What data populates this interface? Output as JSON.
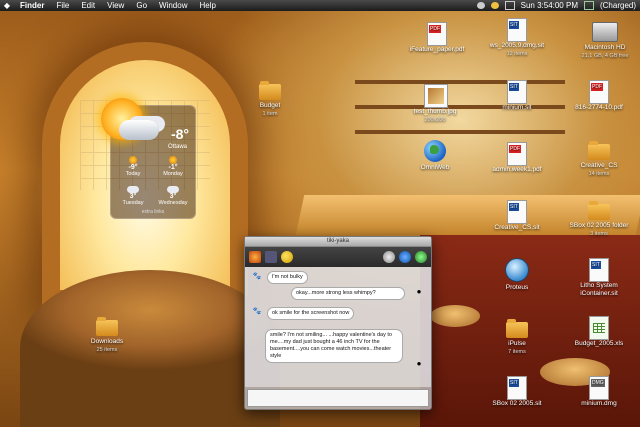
{
  "menubar": {
    "apple": "",
    "items": [
      "Finder",
      "File",
      "Edit",
      "View",
      "Go",
      "Window",
      "Help"
    ],
    "clock": "Sun 3:54:00 PM",
    "battery": "(Charged)"
  },
  "weather": {
    "city": "Ottawa",
    "temp": "-8°",
    "days": [
      {
        "label": "Today",
        "temp": "-9°",
        "icon": "sunny"
      },
      {
        "label": "Monday",
        "temp": "-1°",
        "icon": "sunny"
      },
      {
        "label": "Tuesday",
        "temp": "3°",
        "icon": "cloudy"
      },
      {
        "label": "Wednesday",
        "temp": "3°",
        "icon": "cloudy"
      }
    ],
    "extra": "extra links"
  },
  "icons": {
    "budget": {
      "label": "Budget",
      "sub": "1 item"
    },
    "downloads": {
      "label": "Downloads",
      "sub": "25 items"
    },
    "pdf_top": {
      "label": "iFeature_paper.pdf"
    },
    "zip_top": {
      "label": "ws_2005.9.dmg.sit",
      "sub": "12 items"
    },
    "macintosh_hd": {
      "label": "Macintosh HD",
      "sub": "21.1 GB, 4 GB free"
    },
    "test_thumb": {
      "label": "test_thumb.jpg",
      "sub": "200x200"
    },
    "minium_sit": {
      "label": "minium.sit"
    },
    "pdf_816": {
      "label": "816-2774-10.pdf"
    },
    "omniweb": {
      "label": "OmniWeb"
    },
    "admin_pdf": {
      "label": "admin.week1.pdf"
    },
    "creative_cs": {
      "label": "Creative_CS",
      "sub": "14 items"
    },
    "creative_sit": {
      "label": "Creative_CS.sit"
    },
    "sbox_folder": {
      "label": "SBox 02 2005 folder",
      "sub": "3 items"
    },
    "proteus": {
      "label": "Proteus"
    },
    "litho": {
      "label": "Litho System iContainer.sit"
    },
    "ipulse": {
      "label": "iPulse",
      "sub": "7 items"
    },
    "budget_xls": {
      "label": "Budget_2005.xls"
    },
    "sbox_sit": {
      "label": "SBox 02 2005.sit"
    },
    "minium_dmg": {
      "label": "minium.dmg"
    }
  },
  "chat": {
    "title": "tiki-yaka",
    "messages": [
      {
        "side": "left",
        "text": "I'm not bulky"
      },
      {
        "side": "right",
        "text": "okay...more strong less whimpy?"
      },
      {
        "side": "left",
        "text": "ok smile for the screenshot now"
      },
      {
        "side": "right",
        "text": "smile? I'm not smiling... ...happy valentine's day to me....my dad just bought a 46 inch TV for the basement....you can come watch movies...theater style"
      }
    ]
  },
  "colors": {
    "menubar": "#1c1c1c",
    "accent": "#f7c45a",
    "chat_bg": "#c8c8cd"
  }
}
